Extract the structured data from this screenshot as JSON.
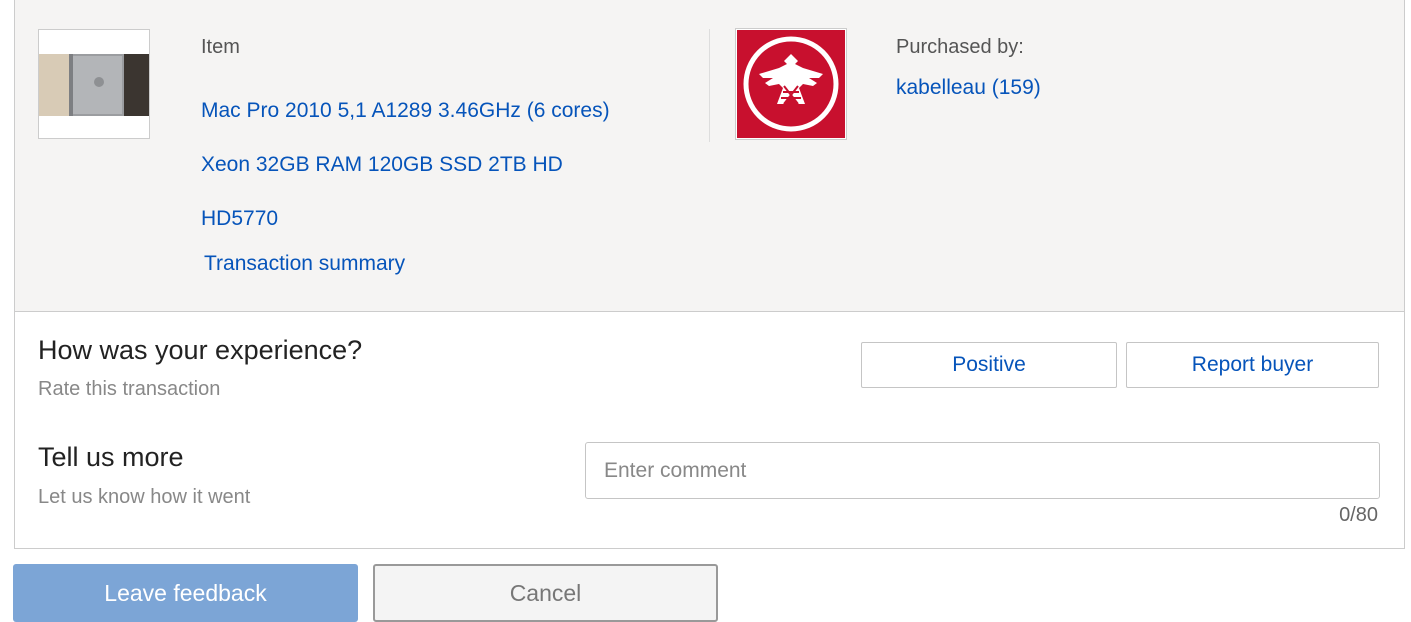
{
  "item": {
    "label": "Item",
    "title_line1": "Mac Pro 2010 5,1 A1289  3.46GHz (6 cores)",
    "title_line2": "Xeon 32GB RAM 120GB SSD 2TB HD",
    "title_line3": "HD5770",
    "transaction_summary": "Transaction summary"
  },
  "buyer": {
    "label": "Purchased by:",
    "name": "kabelleau (159)",
    "logo_icon": "thunderbird-emblem-icon",
    "logo_color": "#c8102e"
  },
  "rating": {
    "heading": "How was your experience?",
    "subheading": "Rate this transaction",
    "positive_label": "Positive",
    "report_label": "Report buyer"
  },
  "comment": {
    "heading": "Tell us more",
    "subheading": "Let us know how it went",
    "placeholder": "Enter comment",
    "value": "",
    "counter": "0/80"
  },
  "actions": {
    "leave_feedback": "Leave feedback",
    "cancel": "Cancel"
  },
  "colors": {
    "link": "#0654ba",
    "primary_button": "#7ca5d6",
    "panel_background": "#f5f4f3"
  }
}
